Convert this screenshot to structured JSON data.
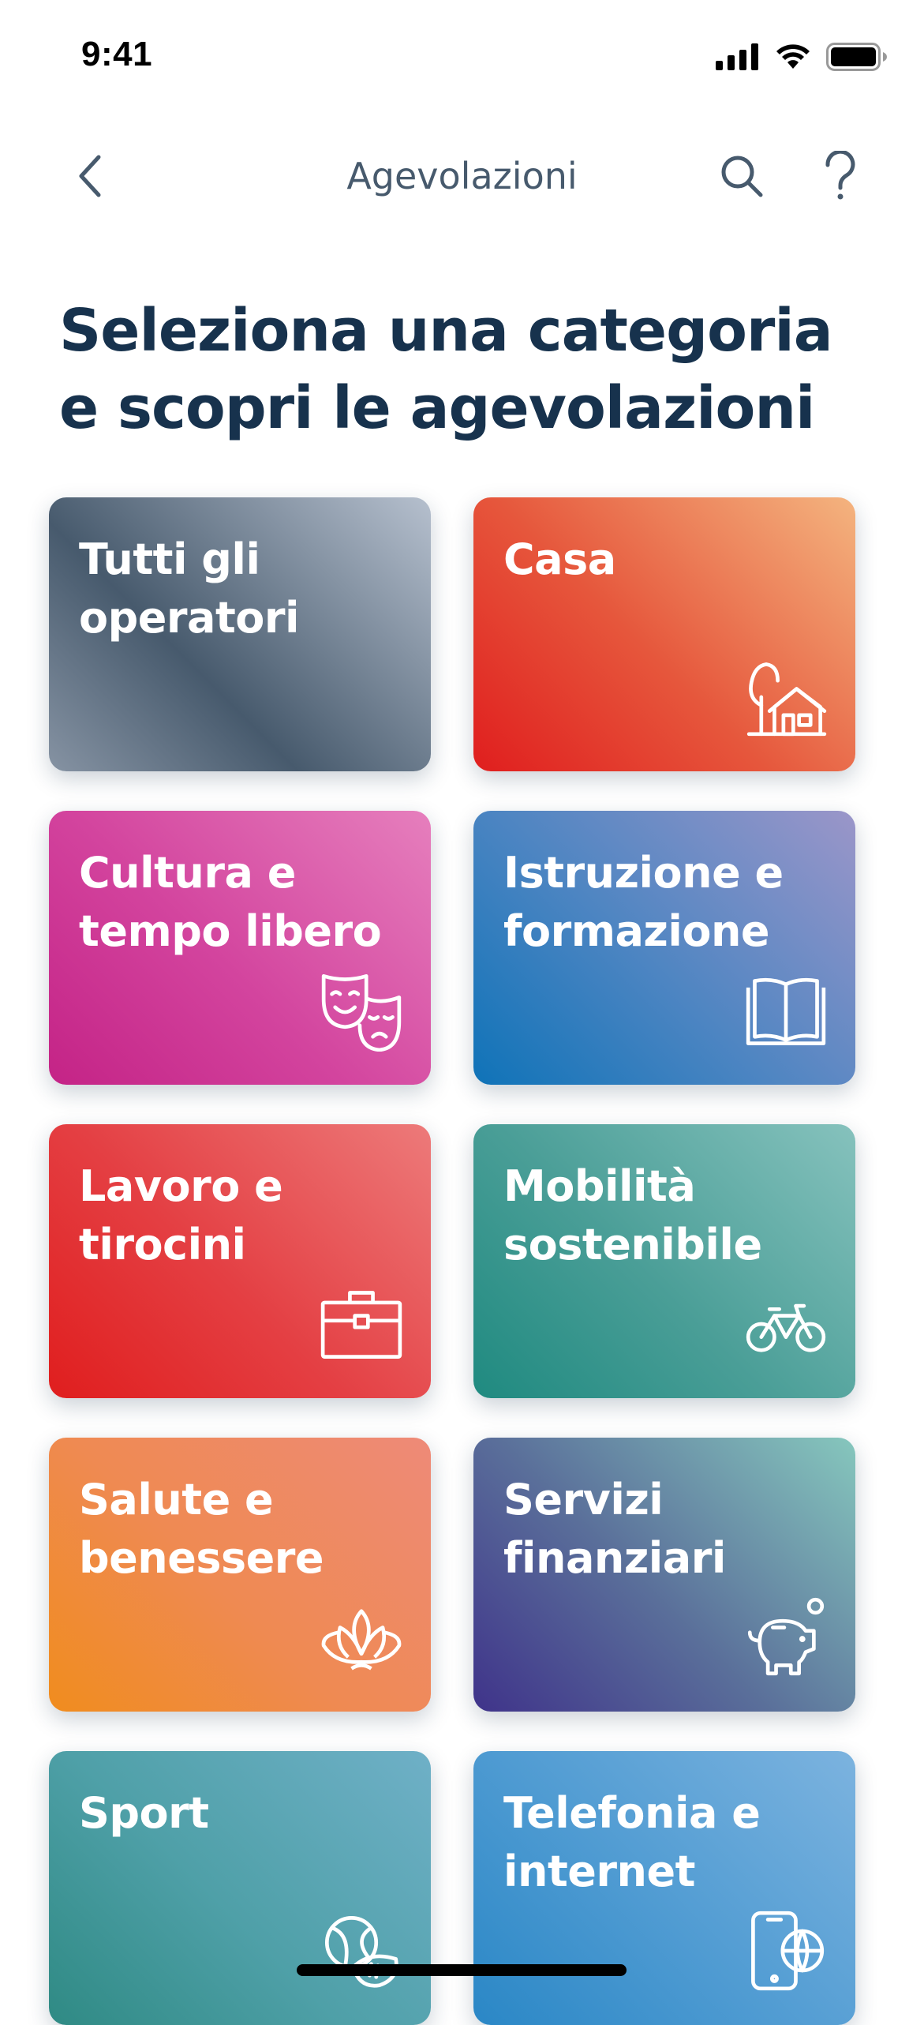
{
  "status_bar": {
    "time": "9:41"
  },
  "nav": {
    "title": "Agevolazioni"
  },
  "heading": "Seleziona una categoria e scopri le agevolazioni",
  "categories": [
    {
      "label": "Tutti gli operatori",
      "icon": "none",
      "gradient": [
        "#475a6d",
        "#b6c0ce"
      ]
    },
    {
      "label": "Casa",
      "icon": "house-icon",
      "gradient": [
        "#e01e1e",
        "#f4b47f"
      ]
    },
    {
      "label": "Cultura e tempo libero",
      "icon": "theater-masks-icon",
      "gradient": [
        "#c42386",
        "#e67fbd"
      ]
    },
    {
      "label": "Istruzione e formazione",
      "icon": "open-book-icon",
      "gradient": [
        "#0f73b8",
        "#9b96c9"
      ]
    },
    {
      "label": "Lavoro e tirocini",
      "icon": "briefcase-icon",
      "gradient": [
        "#e01e1e",
        "#ed7a7a"
      ]
    },
    {
      "label": "Mobilità sostenibile",
      "icon": "bicycle-icon",
      "gradient": [
        "#1f8a80",
        "#86c2bd"
      ]
    },
    {
      "label": "Salute e benessere",
      "icon": "lotus-icon",
      "gradient": [
        "#f08c1e",
        "#ee8a78"
      ]
    },
    {
      "label": "Servizi finanziari",
      "icon": "piggy-bank-icon",
      "gradient": [
        "#3f338a",
        "#86c7bd"
      ]
    },
    {
      "label": "Sport",
      "icon": "sport-balls-icon",
      "gradient": [
        "#2f8a84",
        "#6fb0c7"
      ]
    },
    {
      "label": "Telefonia e internet",
      "icon": "smartphone-globe-icon",
      "gradient": [
        "#2a87c6",
        "#7cb3df"
      ]
    }
  ]
}
